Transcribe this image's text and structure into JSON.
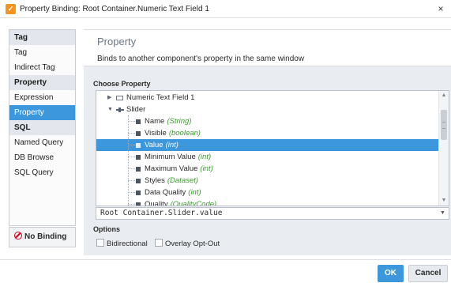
{
  "window": {
    "title": "Property Binding: Root Container.Numeric Text Field 1",
    "app_icon": "ignition-logo-icon",
    "close_glyph": "×"
  },
  "sidebar": {
    "items": [
      {
        "label": "Tag",
        "kind": "header"
      },
      {
        "label": "Tag",
        "kind": "item"
      },
      {
        "label": "Indirect Tag",
        "kind": "item"
      },
      {
        "label": "Property",
        "kind": "header"
      },
      {
        "label": "Expression",
        "kind": "item"
      },
      {
        "label": "Property",
        "kind": "item",
        "active": true
      },
      {
        "label": "SQL",
        "kind": "header"
      },
      {
        "label": "Named Query",
        "kind": "item"
      },
      {
        "label": "DB Browse",
        "kind": "item"
      },
      {
        "label": "SQL Query",
        "kind": "item"
      }
    ],
    "no_binding_label": "No Binding"
  },
  "main": {
    "title": "Property",
    "description": "Binds to another component's property in the same window",
    "choose_label": "Choose Property",
    "tree": [
      {
        "label": "Numeric Text Field 1",
        "type": "",
        "level": 0,
        "icon": "text-field-icon",
        "caret": "right"
      },
      {
        "label": "Slider",
        "type": "",
        "level": 0,
        "icon": "slider-icon",
        "caret": "down"
      },
      {
        "label": "Name",
        "type": "(String)",
        "level": 1,
        "icon": "property-icon"
      },
      {
        "label": "Visible",
        "type": "(boolean)",
        "level": 1,
        "icon": "property-icon"
      },
      {
        "label": "Value",
        "type": "(int)",
        "level": 1,
        "icon": "property-icon",
        "selected": true
      },
      {
        "label": "Minimum Value",
        "type": "(int)",
        "level": 1,
        "icon": "property-icon"
      },
      {
        "label": "Maximum Value",
        "type": "(int)",
        "level": 1,
        "icon": "property-icon"
      },
      {
        "label": "Styles",
        "type": "(Dataset)",
        "level": 1,
        "icon": "property-icon"
      },
      {
        "label": "Data Quality",
        "type": "(int)",
        "level": 1,
        "icon": "property-icon"
      },
      {
        "label": "Quality",
        "type": "(QualityCode)",
        "level": 1,
        "icon": "property-icon"
      }
    ],
    "selected_path": "Root Container.Slider.value",
    "options_label": "Options",
    "options": [
      {
        "label": "Bidirectional",
        "checked": false
      },
      {
        "label": "Overlay Opt-Out",
        "checked": false
      }
    ]
  },
  "footer": {
    "ok_label": "OK",
    "cancel_label": "Cancel"
  },
  "colors": {
    "accent": "#3d97dc",
    "type_green": "#3c9a2f",
    "no_binding_red": "#d0021b"
  }
}
